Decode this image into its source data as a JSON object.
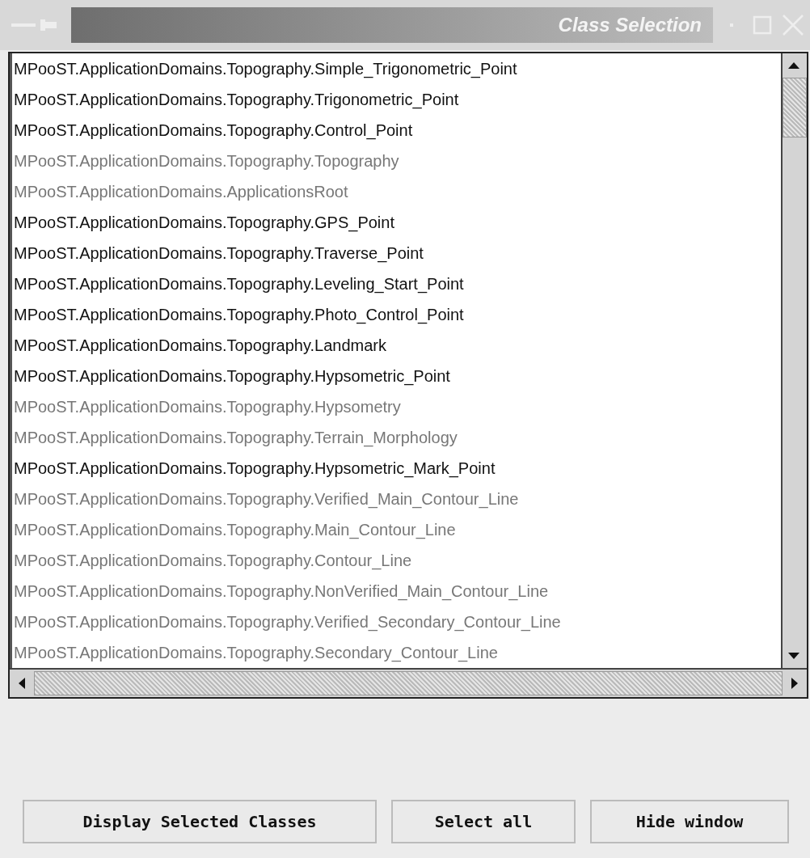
{
  "window": {
    "title": "Class Selection"
  },
  "classes": [
    {
      "name": "MPooST.ApplicationDomains.Topography.Simple_Trigonometric_Point",
      "selected": true
    },
    {
      "name": "MPooST.ApplicationDomains.Topography.Trigonometric_Point",
      "selected": true
    },
    {
      "name": "MPooST.ApplicationDomains.Topography.Control_Point",
      "selected": true
    },
    {
      "name": "MPooST.ApplicationDomains.Topography.Topography",
      "selected": false
    },
    {
      "name": "MPooST.ApplicationDomains.ApplicationsRoot",
      "selected": false
    },
    {
      "name": "MPooST.ApplicationDomains.Topography.GPS_Point",
      "selected": true
    },
    {
      "name": "MPooST.ApplicationDomains.Topography.Traverse_Point",
      "selected": true
    },
    {
      "name": "MPooST.ApplicationDomains.Topography.Leveling_Start_Point",
      "selected": true
    },
    {
      "name": "MPooST.ApplicationDomains.Topography.Photo_Control_Point",
      "selected": true
    },
    {
      "name": "MPooST.ApplicationDomains.Topography.Landmark",
      "selected": true
    },
    {
      "name": "MPooST.ApplicationDomains.Topography.Hypsometric_Point",
      "selected": true
    },
    {
      "name": "MPooST.ApplicationDomains.Topography.Hypsometry",
      "selected": false
    },
    {
      "name": "MPooST.ApplicationDomains.Topography.Terrain_Morphology",
      "selected": false
    },
    {
      "name": "MPooST.ApplicationDomains.Topography.Hypsometric_Mark_Point",
      "selected": true
    },
    {
      "name": "MPooST.ApplicationDomains.Topography.Verified_Main_Contour_Line",
      "selected": false
    },
    {
      "name": "MPooST.ApplicationDomains.Topography.Main_Contour_Line",
      "selected": false
    },
    {
      "name": "MPooST.ApplicationDomains.Topography.Contour_Line",
      "selected": false
    },
    {
      "name": "MPooST.ApplicationDomains.Topography.NonVerified_Main_Contour_Line",
      "selected": false
    },
    {
      "name": "MPooST.ApplicationDomains.Topography.Verified_Secondary_Contour_Line",
      "selected": false
    },
    {
      "name": "MPooST.ApplicationDomains.Topography.Secondary_Contour_Line",
      "selected": false
    }
  ],
  "buttons": [
    "Display Selected Classes",
    "Select all",
    "Hide window"
  ]
}
